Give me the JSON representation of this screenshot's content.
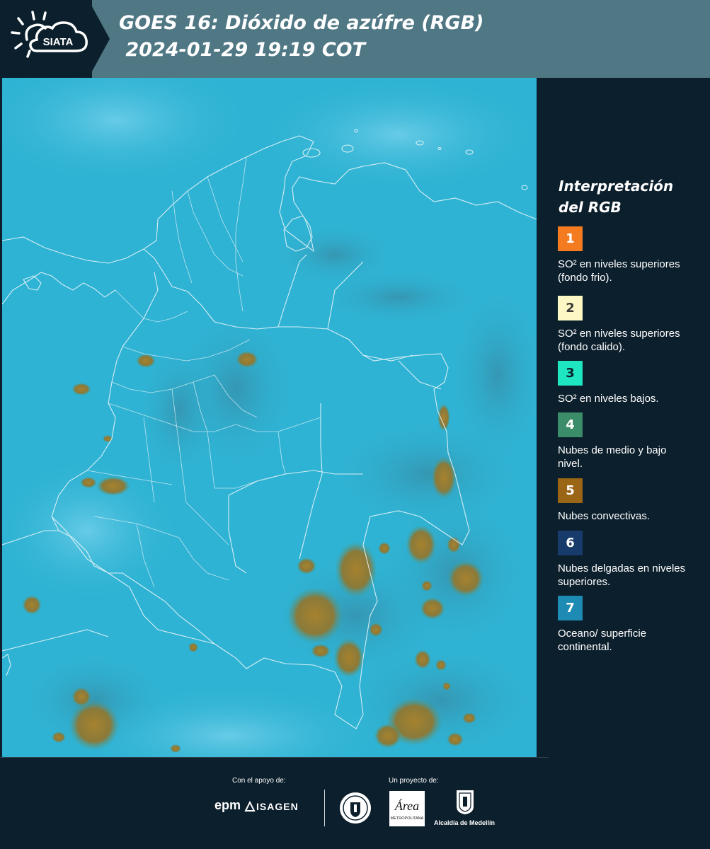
{
  "header": {
    "logo_text": "SIATA",
    "title_line1": "GOES 16: Dióxido de azúfre (RGB)",
    "title_line2": " 2024-01-29 19:19 COT"
  },
  "map": {
    "base_color": "#2fb3d4",
    "convective_color": "#9c7a2a",
    "border_color": "#e8f4f8"
  },
  "legend": {
    "title": "Interpretación del RGB",
    "items": [
      {
        "number": "1",
        "color": "#f47b20",
        "text_color": "#ffffff",
        "label": "SO² en niveles superiores (fondo frio)."
      },
      {
        "number": "2",
        "color": "#fdf6c5",
        "text_color": "#3a3a3a",
        "label": "SO² en niveles superiores (fondo calido)."
      },
      {
        "number": "3",
        "color": "#1de6c0",
        "text_color": "#0c1f2c",
        "label": "SO² en niveles bajos."
      },
      {
        "number": "4",
        "color": "#3b8c68",
        "text_color": "#ffffff",
        "label": "Nubes de medio y bajo nivel."
      },
      {
        "number": "5",
        "color": "#9a6515",
        "text_color": "#ffffff",
        "label": "Nubes convectivas."
      },
      {
        "number": "6",
        "color": "#173c6b",
        "text_color": "#ffffff",
        "label": "Nubes delgadas en niveles superiores."
      },
      {
        "number": "7",
        "color": "#1d8bb3",
        "text_color": "#ffffff",
        "label": "Oceano/ superficie continental."
      }
    ]
  },
  "footer": {
    "support_label": "Con el apoyo de:",
    "project_label": "Un proyecto de:",
    "epm_logo": "epm",
    "isagen_logo": "ISAGEN",
    "area_logo_text": "Área",
    "area_logo_sub": "METROPOLITANA",
    "alcaldia_label": "Alcaldía de Medellín"
  }
}
